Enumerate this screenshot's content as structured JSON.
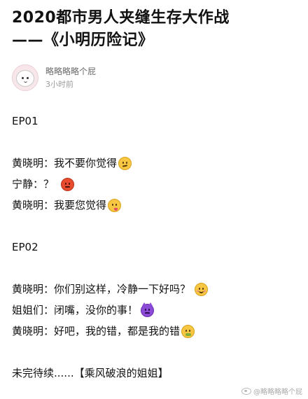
{
  "post": {
    "title_line1": "2020都市男人夹缝生存大作战",
    "title_line2": "——《小明历险记》"
  },
  "author": {
    "name": "略略略略个屁",
    "time": "3小时前",
    "avatar": "cartoon-face-avatar"
  },
  "content": {
    "ep1": "EP01",
    "ep1_lines": [
      {
        "text": "黄晓明：我不要你觉得",
        "emoji": "confused-face"
      },
      {
        "text": "宁静：？",
        "emoji": "angry-face"
      },
      {
        "text": "黄晓明：我要您觉得",
        "emoji": "face-savoring-food"
      }
    ],
    "ep2": "EP02",
    "ep2_lines": [
      {
        "text": "黄晓明：你们别这样，冷静一下好吗？",
        "emoji": "smiling-blushing-face"
      },
      {
        "text": "姐姐们：闭嘴，没你的事！",
        "emoji": "angry-devil-face"
      },
      {
        "text": "黄晓明：好吧，我的错，都是我的错",
        "emoji": "nauseated-face"
      }
    ],
    "ending": "未完待续......【乘风破浪的姐姐】"
  },
  "watermark": {
    "text": "@略略略略个屁"
  },
  "colors": {
    "text": "#111111",
    "secondary": "#6a6a6a",
    "muted": "#9a9a9a"
  }
}
